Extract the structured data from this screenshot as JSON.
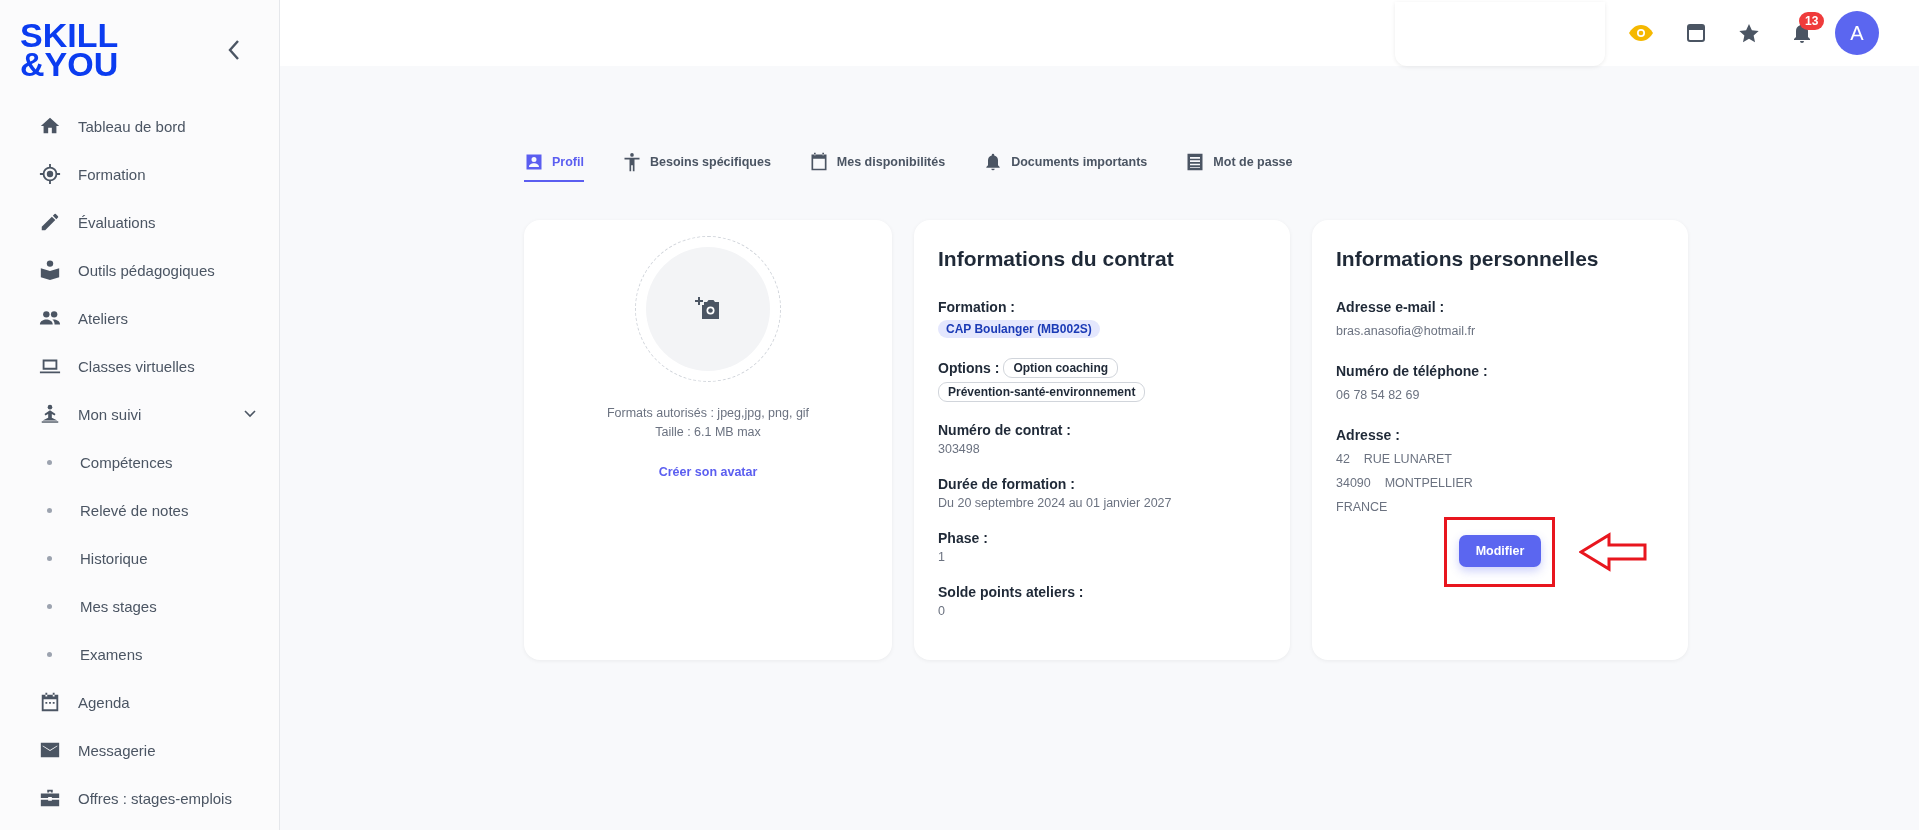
{
  "sidebar": {
    "logo": [
      "SKILL",
      "&YOU"
    ],
    "items": [
      {
        "label": "Tableau de bord",
        "kind": "main"
      },
      {
        "label": "Formation",
        "kind": "main"
      },
      {
        "label": "Évaluations",
        "kind": "main"
      },
      {
        "label": "Outils pédagogiques",
        "kind": "main"
      },
      {
        "label": "Ateliers",
        "kind": "main"
      },
      {
        "label": "Classes virtuelles",
        "kind": "main"
      },
      {
        "label": "Mon suivi",
        "kind": "group",
        "expanded": true,
        "children": [
          {
            "label": "Compétences"
          },
          {
            "label": "Relevé de notes"
          },
          {
            "label": "Historique"
          },
          {
            "label": "Mes stages"
          },
          {
            "label": "Examens"
          }
        ]
      },
      {
        "label": "Agenda",
        "kind": "main"
      },
      {
        "label": "Messagerie",
        "kind": "main"
      },
      {
        "label": "Offres : stages-emplois",
        "kind": "main"
      }
    ]
  },
  "topbar": {
    "notification_count": "13",
    "avatar_letter": "A"
  },
  "tabs": [
    {
      "label": "Profil",
      "selected": true
    },
    {
      "label": "Besoins spécifiques",
      "selected": false
    },
    {
      "label": "Mes disponibilités",
      "selected": false
    },
    {
      "label": "Documents importants",
      "selected": false
    },
    {
      "label": "Mot de passe",
      "selected": false
    }
  ],
  "avatar_card": {
    "formats": "Formats autorisés : jpeg,jpg, png, gif",
    "size": "Taille : 6.1 MB max",
    "link": "Créer son avatar"
  },
  "contract": {
    "title": "Informations du contrat",
    "formation_label": "Formation :",
    "formation": "CAP Boulanger (MB002S)",
    "options_label": "Options :",
    "options": [
      "Option coaching",
      "Prévention-santé-environnement"
    ],
    "fields": [
      {
        "label": "Numéro de contrat :",
        "value": "303498"
      },
      {
        "label": "Durée de formation :",
        "value": "Du 20 septembre 2024 au 01 janvier 2027"
      },
      {
        "label": "Phase :",
        "value": "1"
      },
      {
        "label": "Solde points ateliers :",
        "value": "0"
      }
    ]
  },
  "personal": {
    "title": "Informations personnelles",
    "fields": [
      {
        "label": "Adresse e-mail :",
        "lines": [
          "bras.anasofia@hotmail.fr"
        ]
      },
      {
        "label": "Numéro de téléphone :",
        "lines": [
          "06 78 54 82 69"
        ]
      },
      {
        "label": "Adresse :",
        "lines": [
          "42    RUE LUNARET",
          "34090    MONTPELLIER",
          "FRANCE"
        ]
      }
    ],
    "button": "Modifier"
  }
}
